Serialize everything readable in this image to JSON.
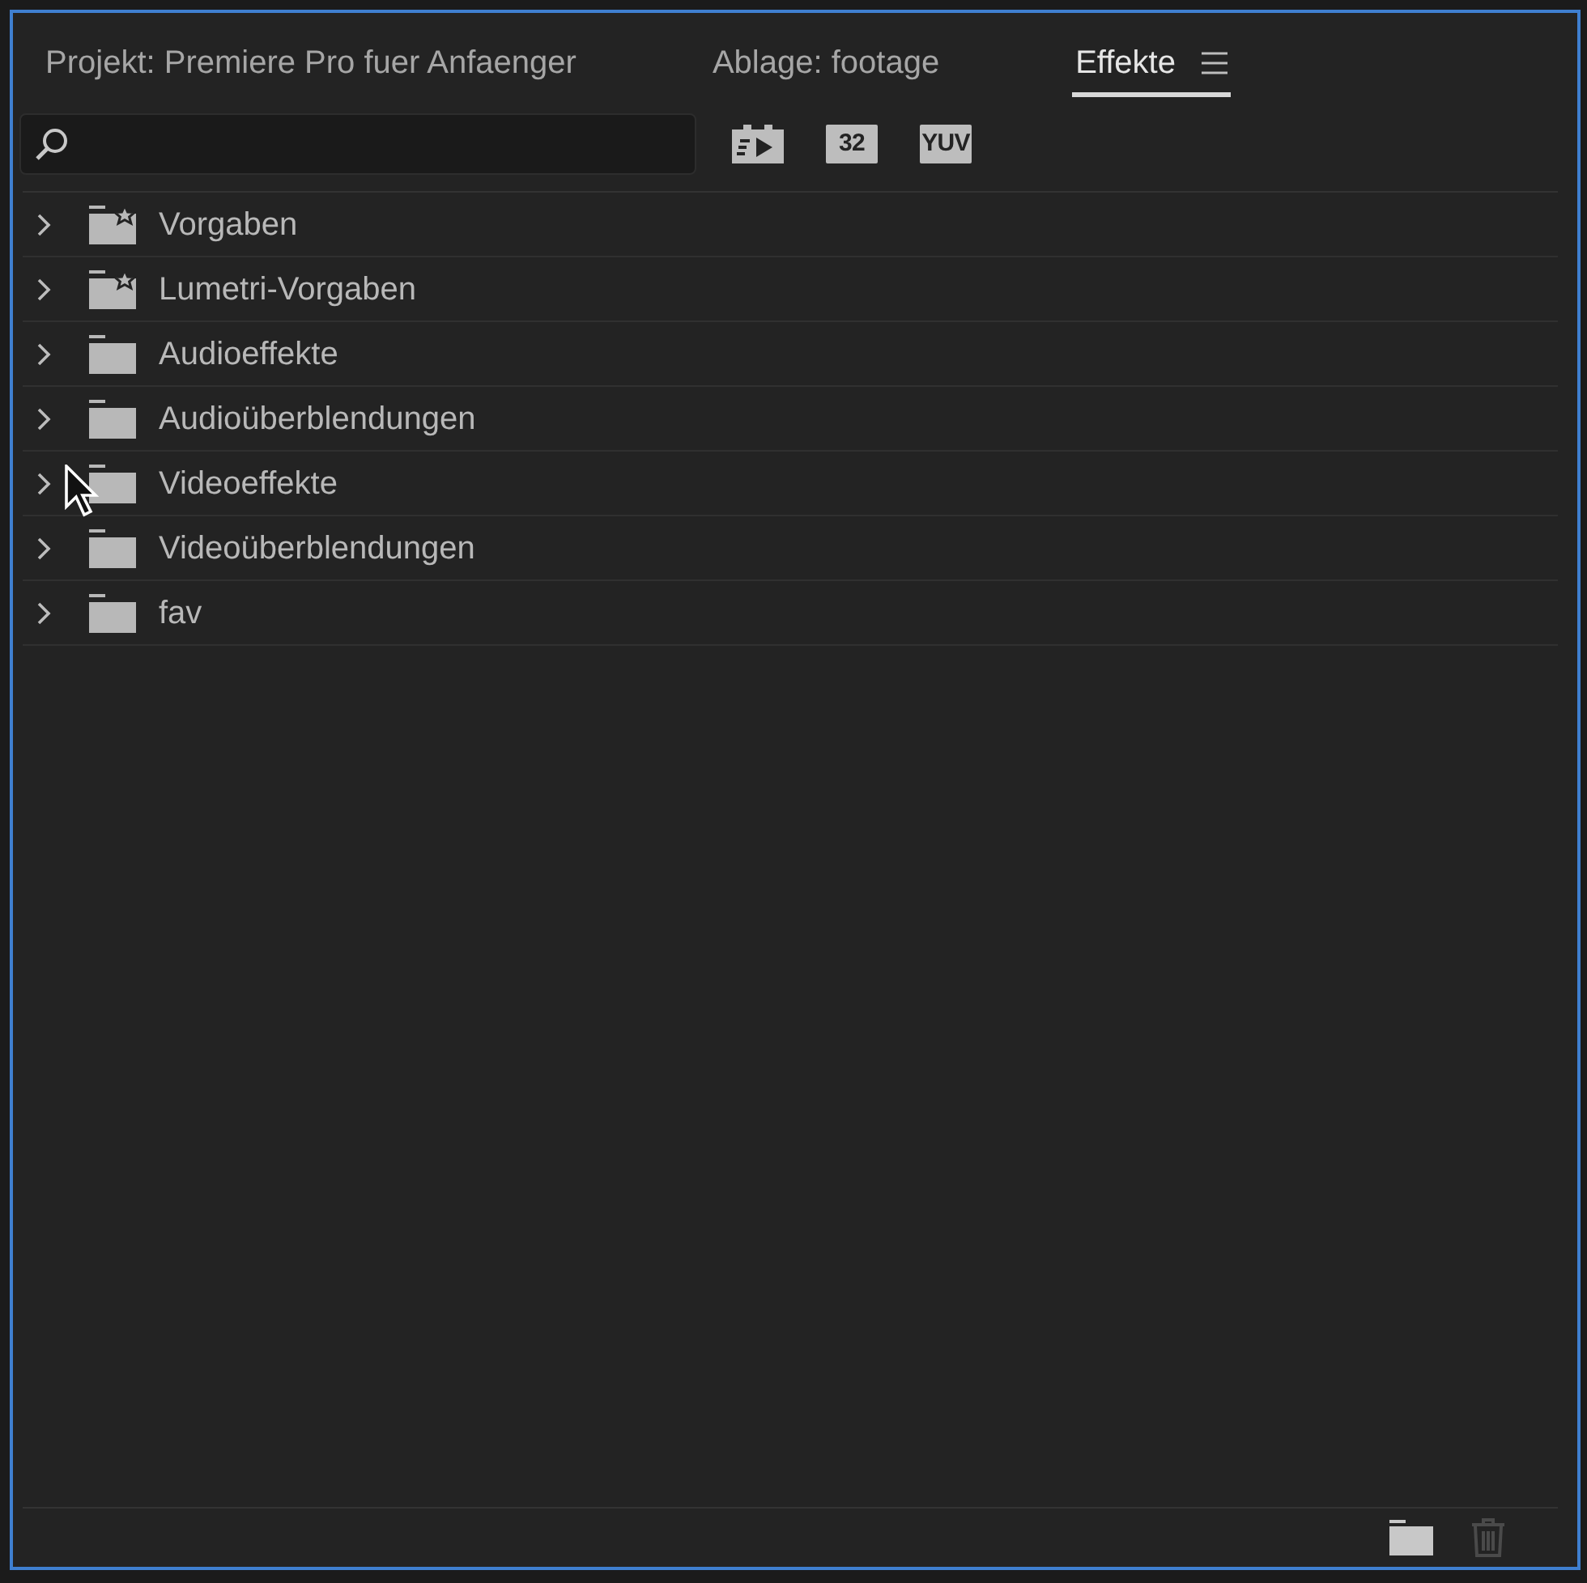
{
  "tabs": [
    {
      "label": "Projekt: Premiere Pro fuer Anfaenger",
      "selected": false
    },
    {
      "label": "Ablage: footage",
      "selected": false
    },
    {
      "label": "Effekte",
      "selected": true
    }
  ],
  "filter_buttons": [
    {
      "kind": "icon"
    },
    {
      "kind": "text",
      "label": "32"
    },
    {
      "kind": "text",
      "label": "YUV"
    }
  ],
  "items": [
    {
      "label": "Vorgaben",
      "kind": "preset",
      "expanded": false
    },
    {
      "label": "Lumetri-Vorgaben",
      "kind": "preset",
      "expanded": false
    },
    {
      "label": "Audioeffekte",
      "kind": "folder",
      "expanded": false
    },
    {
      "label": "Audioüberblendungen",
      "kind": "folder",
      "expanded": false
    },
    {
      "label": "Videoeffekte",
      "kind": "folder",
      "expanded": false
    },
    {
      "label": "Videoüberblendungen",
      "kind": "folder",
      "expanded": false
    },
    {
      "label": "fav",
      "kind": "folder",
      "expanded": false
    }
  ],
  "footer": {
    "delete_disabled": true
  }
}
